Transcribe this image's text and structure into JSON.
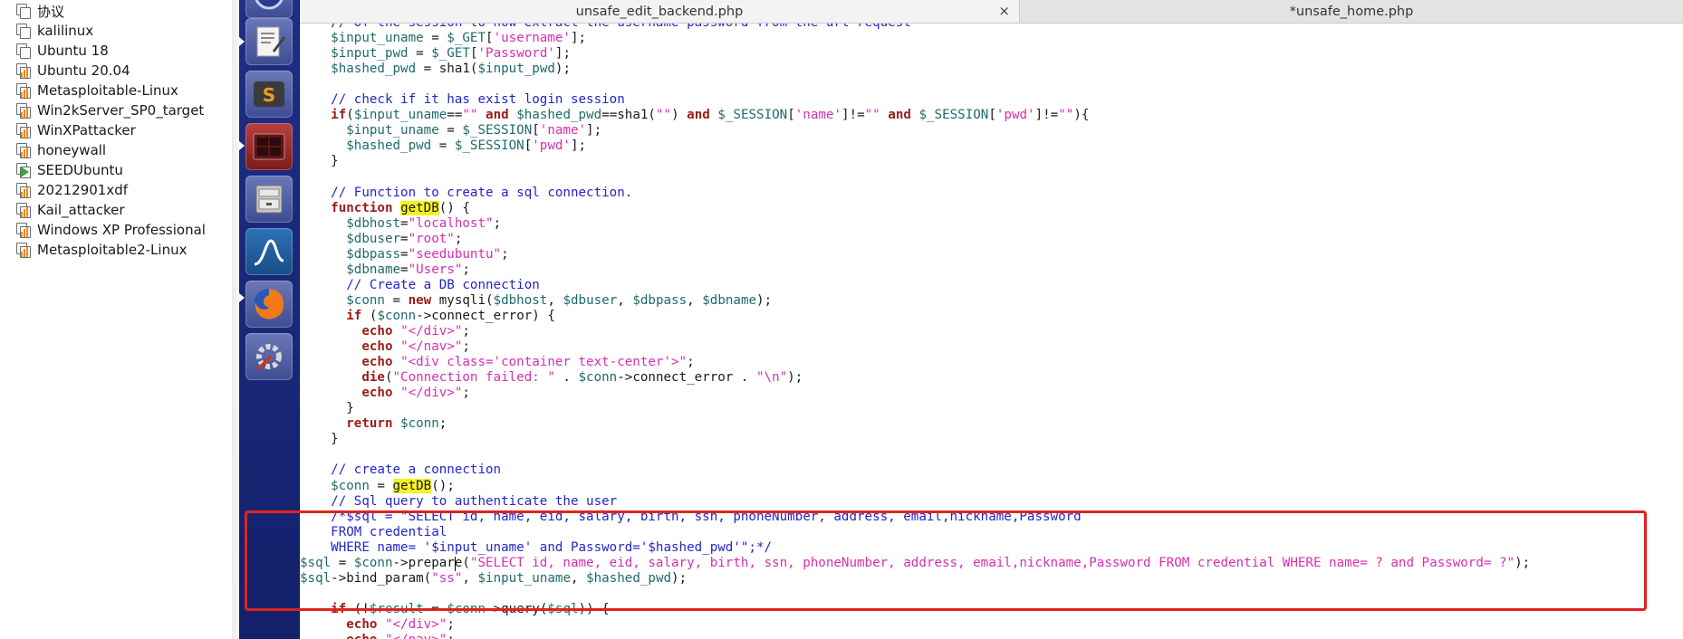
{
  "vm_list": [
    {
      "name": "协议",
      "icon": "vm-icon"
    },
    {
      "name": "kalilinux",
      "icon": "vm-icon"
    },
    {
      "name": "Ubuntu 18",
      "icon": "vm-icon"
    },
    {
      "name": "Ubuntu 20.04",
      "icon": "vm-running-icon"
    },
    {
      "name": "Metasploitable-Linux",
      "icon": "vm-running-icon"
    },
    {
      "name": "Win2kServer_SP0_target",
      "icon": "vm-running-icon"
    },
    {
      "name": "WinXPattacker",
      "icon": "vm-running-icon"
    },
    {
      "name": "honeywall",
      "icon": "vm-running-icon"
    },
    {
      "name": "SEEDUbuntu",
      "icon": "vm-play-icon"
    },
    {
      "name": "20212901xdf",
      "icon": "vm-running-icon"
    },
    {
      "name": "Kail_attacker",
      "icon": "vm-running-icon"
    },
    {
      "name": "Windows XP Professional",
      "icon": "vm-running-icon"
    },
    {
      "name": "Metasploitable2-Linux",
      "icon": "vm-running-icon"
    }
  ],
  "launcher": [
    {
      "name": "text-editor-icon"
    },
    {
      "name": "sublime-text-icon"
    },
    {
      "name": "terminal-icon"
    },
    {
      "name": "file-manager-icon"
    },
    {
      "name": "wireshark-icon"
    },
    {
      "name": "firefox-icon"
    },
    {
      "name": "system-settings-icon"
    }
  ],
  "tabs": {
    "tab1": "unsafe_edit_backend.php",
    "tab1_close": "×",
    "tab2": "*unsafe_home.php"
  },
  "colors": {
    "variable": "#206a6a",
    "string": "#d62fb2",
    "keyword": "#9b1b1b",
    "comment": "#2525c8",
    "highlight": "#f6f222",
    "annotation_box": "#e0231f"
  },
  "code_lines": [
    [
      [
        "cmt",
        "    // of the session to now extract the username password from the url request"
      ]
    ],
    [
      [
        "txt",
        "    "
      ],
      [
        "var",
        "$input_uname"
      ],
      [
        "txt",
        " = "
      ],
      [
        "var",
        "$_GET"
      ],
      [
        "txt",
        "["
      ],
      [
        "str",
        "'username'"
      ],
      [
        "txt",
        "];"
      ]
    ],
    [
      [
        "txt",
        "    "
      ],
      [
        "var",
        "$input_pwd"
      ],
      [
        "txt",
        " = "
      ],
      [
        "var",
        "$_GET"
      ],
      [
        "txt",
        "["
      ],
      [
        "str",
        "'Password'"
      ],
      [
        "txt",
        "];"
      ]
    ],
    [
      [
        "txt",
        "    "
      ],
      [
        "var",
        "$hashed_pwd"
      ],
      [
        "txt",
        " = sha1("
      ],
      [
        "var",
        "$input_pwd"
      ],
      [
        "txt",
        ");"
      ]
    ],
    [
      [
        "txt",
        ""
      ]
    ],
    [
      [
        "cmt",
        "    // check if it has exist login session"
      ]
    ],
    [
      [
        "txt",
        "    "
      ],
      [
        "kw",
        "if"
      ],
      [
        "txt",
        "("
      ],
      [
        "var",
        "$input_uname"
      ],
      [
        "txt",
        "=="
      ],
      [
        "str",
        "\"\""
      ],
      [
        "txt",
        " "
      ],
      [
        "kw",
        "and"
      ],
      [
        "txt",
        " "
      ],
      [
        "var",
        "$hashed_pwd"
      ],
      [
        "txt",
        "==sha1("
      ],
      [
        "str",
        "\"\""
      ],
      [
        "txt",
        ") "
      ],
      [
        "kw",
        "and"
      ],
      [
        "txt",
        " "
      ],
      [
        "var",
        "$_SESSION"
      ],
      [
        "txt",
        "["
      ],
      [
        "str",
        "'name'"
      ],
      [
        "txt",
        "]!="
      ],
      [
        "str",
        "\"\""
      ],
      [
        "txt",
        " "
      ],
      [
        "kw",
        "and"
      ],
      [
        "txt",
        " "
      ],
      [
        "var",
        "$_SESSION"
      ],
      [
        "txt",
        "["
      ],
      [
        "str",
        "'pwd'"
      ],
      [
        "txt",
        "]!="
      ],
      [
        "str",
        "\"\""
      ],
      [
        "txt",
        "){"
      ]
    ],
    [
      [
        "txt",
        "      "
      ],
      [
        "var",
        "$input_uname"
      ],
      [
        "txt",
        " = "
      ],
      [
        "var",
        "$_SESSION"
      ],
      [
        "txt",
        "["
      ],
      [
        "str",
        "'name'"
      ],
      [
        "txt",
        "];"
      ]
    ],
    [
      [
        "txt",
        "      "
      ],
      [
        "var",
        "$hashed_pwd"
      ],
      [
        "txt",
        " = "
      ],
      [
        "var",
        "$_SESSION"
      ],
      [
        "txt",
        "["
      ],
      [
        "str",
        "'pwd'"
      ],
      [
        "txt",
        "];"
      ]
    ],
    [
      [
        "txt",
        "    }"
      ]
    ],
    [
      [
        "txt",
        ""
      ]
    ],
    [
      [
        "cmt",
        "    // Function to create a sql connection."
      ]
    ],
    [
      [
        "txt",
        "    "
      ],
      [
        "kw",
        "function"
      ],
      [
        "txt",
        " "
      ],
      [
        "hl",
        "getDB"
      ],
      [
        "txt",
        "() {"
      ]
    ],
    [
      [
        "txt",
        "      "
      ],
      [
        "var",
        "$dbhost"
      ],
      [
        "txt",
        "="
      ],
      [
        "str",
        "\"localhost\""
      ],
      [
        "txt",
        ";"
      ]
    ],
    [
      [
        "txt",
        "      "
      ],
      [
        "var",
        "$dbuser"
      ],
      [
        "txt",
        "="
      ],
      [
        "str",
        "\"root\""
      ],
      [
        "txt",
        ";"
      ]
    ],
    [
      [
        "txt",
        "      "
      ],
      [
        "var",
        "$dbpass"
      ],
      [
        "txt",
        "="
      ],
      [
        "str",
        "\"seedubuntu\""
      ],
      [
        "txt",
        ";"
      ]
    ],
    [
      [
        "txt",
        "      "
      ],
      [
        "var",
        "$dbname"
      ],
      [
        "txt",
        "="
      ],
      [
        "str",
        "\"Users\""
      ],
      [
        "txt",
        ";"
      ]
    ],
    [
      [
        "cmt",
        "      // Create a DB connection"
      ]
    ],
    [
      [
        "txt",
        "      "
      ],
      [
        "var",
        "$conn"
      ],
      [
        "txt",
        " = "
      ],
      [
        "kw",
        "new"
      ],
      [
        "txt",
        " mysqli("
      ],
      [
        "var",
        "$dbhost"
      ],
      [
        "txt",
        ", "
      ],
      [
        "var",
        "$dbuser"
      ],
      [
        "txt",
        ", "
      ],
      [
        "var",
        "$dbpass"
      ],
      [
        "txt",
        ", "
      ],
      [
        "var",
        "$dbname"
      ],
      [
        "txt",
        ");"
      ]
    ],
    [
      [
        "txt",
        "      "
      ],
      [
        "kw",
        "if"
      ],
      [
        "txt",
        " ("
      ],
      [
        "var",
        "$conn"
      ],
      [
        "txt",
        "->connect_error) {"
      ]
    ],
    [
      [
        "txt",
        "        "
      ],
      [
        "kw",
        "echo"
      ],
      [
        "txt",
        " "
      ],
      [
        "str",
        "\"</div>\""
      ],
      [
        "txt",
        ";"
      ]
    ],
    [
      [
        "txt",
        "        "
      ],
      [
        "kw",
        "echo"
      ],
      [
        "txt",
        " "
      ],
      [
        "str",
        "\"</nav>\""
      ],
      [
        "txt",
        ";"
      ]
    ],
    [
      [
        "txt",
        "        "
      ],
      [
        "kw",
        "echo"
      ],
      [
        "txt",
        " "
      ],
      [
        "str",
        "\"<div class='container text-center'>\""
      ],
      [
        "txt",
        ";"
      ]
    ],
    [
      [
        "txt",
        "        "
      ],
      [
        "kw",
        "die"
      ],
      [
        "txt",
        "("
      ],
      [
        "str",
        "\"Connection failed: \""
      ],
      [
        "txt",
        " . "
      ],
      [
        "var",
        "$conn"
      ],
      [
        "txt",
        "->connect_error . "
      ],
      [
        "str",
        "\"\\n\""
      ],
      [
        "txt",
        ");"
      ]
    ],
    [
      [
        "txt",
        "        "
      ],
      [
        "kw",
        "echo"
      ],
      [
        "txt",
        " "
      ],
      [
        "str",
        "\"</div>\""
      ],
      [
        "txt",
        ";"
      ]
    ],
    [
      [
        "txt",
        "      }"
      ]
    ],
    [
      [
        "txt",
        "      "
      ],
      [
        "kw",
        "return"
      ],
      [
        "txt",
        " "
      ],
      [
        "var",
        "$conn"
      ],
      [
        "txt",
        ";"
      ]
    ],
    [
      [
        "txt",
        "    }"
      ]
    ],
    [
      [
        "txt",
        ""
      ]
    ],
    [
      [
        "cmt",
        "    // create a connection"
      ]
    ],
    [
      [
        "txt",
        "    "
      ],
      [
        "var",
        "$conn"
      ],
      [
        "txt",
        " = "
      ],
      [
        "hl",
        "getDB"
      ],
      [
        "txt",
        "();"
      ]
    ],
    [
      [
        "cmt",
        "    // Sql query to authenticate the user"
      ]
    ],
    [
      [
        "cmt",
        "    /*$sql = \"SELECT id, name, eid, salary, birth, ssn, phoneNumber, address, email,nickname,Password"
      ]
    ],
    [
      [
        "cmt",
        "    FROM credential"
      ]
    ],
    [
      [
        "cmt",
        "    WHERE name= '$input_uname' and Password='$hashed_pwd'\";*/"
      ]
    ],
    [
      [
        "var",
        "$sql"
      ],
      [
        "txt",
        " = "
      ],
      [
        "var",
        "$conn"
      ],
      [
        "txt",
        "->prepare("
      ],
      [
        "str",
        "\"SELECT id, name, eid, salary, birth, ssn, phoneNumber, address, email,nickname,Password FROM credential WHERE name= ? and Password= ?\""
      ],
      [
        "txt",
        ");"
      ]
    ],
    [
      [
        "var",
        "$sql"
      ],
      [
        "txt",
        "->bind_param("
      ],
      [
        "str",
        "\"ss\""
      ],
      [
        "txt",
        ", "
      ],
      [
        "var",
        "$input_uname"
      ],
      [
        "txt",
        ", "
      ],
      [
        "var",
        "$hashed_pwd"
      ],
      [
        "txt",
        ");"
      ]
    ],
    [
      [
        "txt",
        ""
      ]
    ],
    [
      [
        "txt",
        "    "
      ],
      [
        "kw",
        "if"
      ],
      [
        "txt",
        " (!"
      ],
      [
        "var",
        "$result"
      ],
      [
        "txt",
        " = "
      ],
      [
        "var",
        "$conn"
      ],
      [
        "txt",
        "->query("
      ],
      [
        "var",
        "$sql"
      ],
      [
        "txt",
        ")) {"
      ]
    ],
    [
      [
        "txt",
        "      "
      ],
      [
        "kw",
        "echo"
      ],
      [
        "txt",
        " "
      ],
      [
        "str",
        "\"</div>\""
      ],
      [
        "txt",
        ";"
      ]
    ],
    [
      [
        "txt",
        "      "
      ],
      [
        "kw",
        "echo"
      ],
      [
        "txt",
        " "
      ],
      [
        "str",
        "\"</nav>\""
      ],
      [
        "txt",
        ";"
      ]
    ]
  ]
}
